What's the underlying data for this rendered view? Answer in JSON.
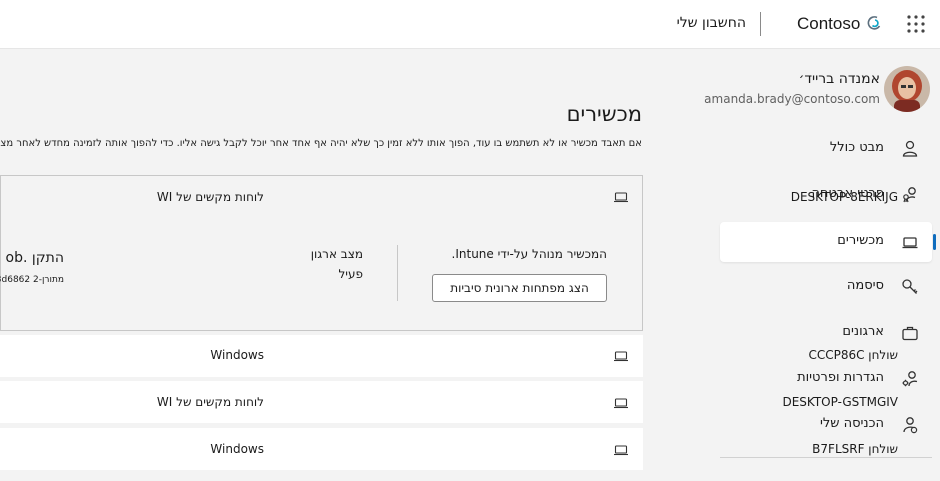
{
  "header": {
    "brand": "Contoso",
    "title": "החשבון שלי"
  },
  "profile": {
    "name": "אמנדה ברייד׳",
    "email": "amanda.brady@contoso.com"
  },
  "nav": {
    "items": [
      {
        "label": "מבט כולל",
        "icon": "person-icon"
      },
      {
        "label": "פרטי אבטחה",
        "icon": "security-info-icon"
      },
      {
        "label": "מכשירים",
        "icon": "laptop-icon",
        "active": true
      },
      {
        "label": "סיסמה",
        "icon": "key-icon"
      },
      {
        "label": "ארגונים",
        "icon": "briefcase-icon"
      },
      {
        "label": "הגדרות ופרטיות",
        "icon": "settings-person-icon"
      },
      {
        "label": "הכניסה שלי",
        "icon": "sign-in-icon"
      }
    ]
  },
  "main": {
    "title": "מכשירים",
    "description": "אם תאבד מכשיר או לא תשתמש בו עוד, הפוך אותו ללא זמין כך שלא יהיה אף אחד אחר יוכל לקבל גישה אליו. כדי להפוך אותה לזמינה מחדש לאחר מצב לא תם"
  },
  "devices": [
    {
      "name": "DESKTOP-8ERKIJG",
      "os": "לוחות מקשים של WI",
      "expanded": true,
      "managed_text": "המכשיר מנוהל על-ידי Intune.",
      "bitlocker_button": "הצג מפתחות ארונית סיביות",
      "status_label": "מצב ארגון",
      "status_value": "פעיל",
      "install_label": "התקן .ob",
      "install_value": "מתורן-2 3d6862"
    },
    {
      "name": "שולחן CCCP86C",
      "os": "Windows"
    },
    {
      "name": "DESKTOP-GSTMGIV",
      "os": "לוחות מקשים של WI"
    },
    {
      "name": "שולחן B7FLSRF",
      "os": "Windows"
    }
  ],
  "colors": {
    "accent": "#0f6cbd",
    "background": "#f3f3f3",
    "card": "#ffffff",
    "logo_gray": "#5c6f7e",
    "logo_teal": "#0ea5c8"
  }
}
